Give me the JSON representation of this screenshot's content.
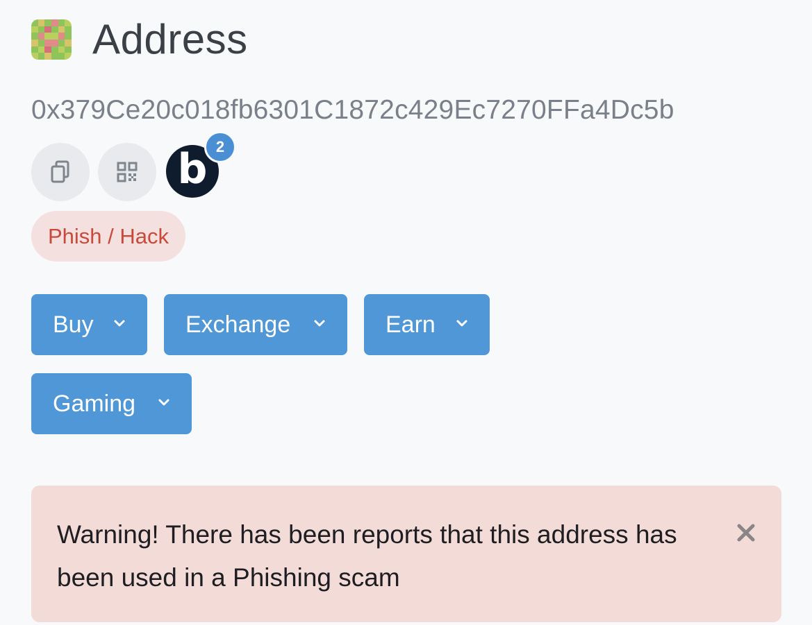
{
  "page": {
    "title": "Address",
    "address": "0x379Ce20c018fb6301C1872c429Ec7270FFa4Dc5b"
  },
  "icons": {
    "copy": "copy-icon",
    "qr": "qr-code-icon",
    "brand_letter": "b",
    "brand_count": "2"
  },
  "tag": {
    "label": "Phish / Hack"
  },
  "actions": [
    {
      "label": "Buy"
    },
    {
      "label": "Exchange"
    },
    {
      "label": "Earn"
    },
    {
      "label": "Gaming"
    }
  ],
  "alert": {
    "message": "Warning! There has been reports that this address has been used in a Phishing scam",
    "close_icon": "close-icon"
  },
  "colors": {
    "background": "#f8f9fb",
    "primary_button": "#5097d7",
    "tag_background": "#f4e0de",
    "tag_text": "#c94a3b",
    "alert_background": "#f3dbd8",
    "badge": "#4a8fd4"
  }
}
